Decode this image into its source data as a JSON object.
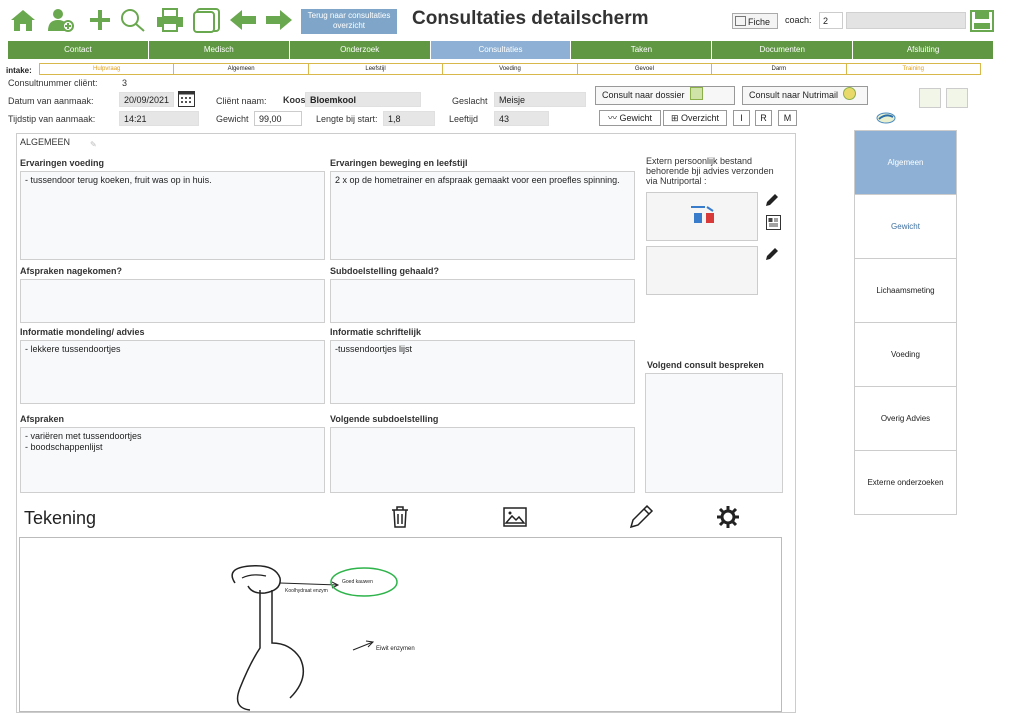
{
  "toolbar": {
    "back_button": "Terug naar consultaties overzicht",
    "title": "Consultaties detailscherm",
    "fiche_label": "Fiche",
    "coach_label": "coach:",
    "coach_value": "2",
    "accent_color": "#6aa84f"
  },
  "nav": {
    "tabs": [
      "Contact",
      "Medisch",
      "Onderzoek",
      "Consultaties",
      "Taken",
      "Documenten",
      "Afsluiting"
    ],
    "active": "Consultaties"
  },
  "intake": {
    "label": "intake:",
    "tabs": [
      "Hulpvraag",
      "Algemeen",
      "Leefstijl",
      "Voeding",
      "Gevoel",
      "Darm",
      "Training"
    ]
  },
  "header": {
    "consult_nr_label": "Consultnummer cliënt:",
    "consult_nr": "3",
    "datum_label": "Datum van aanmaak:",
    "datum": "20/09/2021",
    "tijd_label": "Tijdstip van aanmaak:",
    "tijd": "14:21",
    "client_label": "Cliënt naam:",
    "client_first": "Koos",
    "client_last": "Bloemkool",
    "gewicht_label": "Gewicht",
    "gewicht": "99,00",
    "lengte_label": "Lengte bij start:",
    "lengte": "1,8",
    "geslacht_label": "Geslacht",
    "geslacht": "Meisje",
    "leeftijd_label": "Leeftijd",
    "leeftijd": "43",
    "consult_dossier": "Consult naar dossier",
    "consult_nutrimail": "Consult naar Nutrimail",
    "gewicht_btn": "Gewicht",
    "overzicht_btn": "Overzicht",
    "btn_i": "I",
    "btn_r": "R",
    "btn_m": "M"
  },
  "panel": {
    "section_title": "ALGEMEEN",
    "ervaringen_voeding_label": "Ervaringen voeding",
    "ervaringen_voeding": "- tussendoor terug koeken, fruit was op in huis.",
    "ervaringen_beweging_label": "Ervaringen beweging en leefstijl",
    "ervaringen_beweging": "2 x op de hometrainer en afspraak gemaakt voor een proefles spinning.",
    "extern_label": "Extern persoonlijk bestand behorende bji advies verzonden via Nutriportal :",
    "afspraken_nagekomen_label": "Afspraken nagekomen?",
    "afspraken_nagekomen": "",
    "subdoel_gehaald_label": "Subdoelstelling gehaald?",
    "subdoel_gehaald": "",
    "info_mondeling_label": "Informatie mondeling/ advies",
    "info_mondeling": "- lekkere tussendoortjes",
    "info_schriftelijk_label": "Informatie schriftelijk",
    "info_schriftelijk": "-tussendoortjes lijst",
    "volgend_consult_label": "Volgend consult bespreken",
    "afspraken_label": "Afspraken",
    "afspraken": "-  variëren met tussendoortjes\n- boodschappenlijst",
    "volgende_subdoel_label": "Volgende subdoelstelling",
    "volgende_subdoel": ""
  },
  "side_tabs": [
    "Algemeen",
    "Gewicht",
    "Lichaamsmeting",
    "Voeding",
    "Overig Advies",
    "Externe onderzoeken"
  ],
  "drawing": {
    "title": "Tekening",
    "annotation_1": "Goed kauwen",
    "annotation_2": "Koolhydraat enzym",
    "annotation_3": "Eiwit enzymen"
  }
}
